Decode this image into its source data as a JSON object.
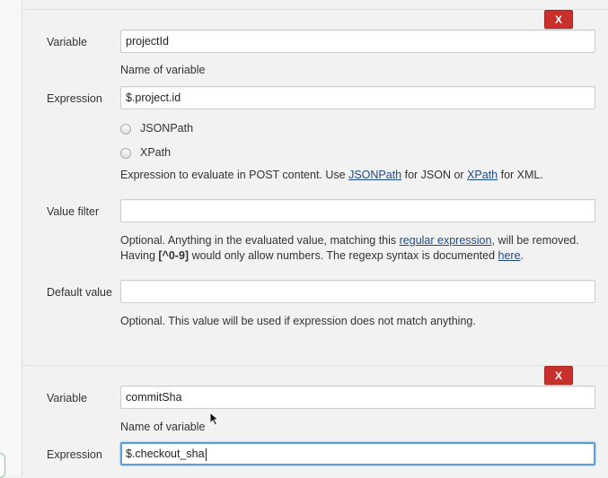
{
  "entries": [
    {
      "delete_label": "X",
      "variable_label": "Variable",
      "variable_value": "projectId",
      "variable_help": "Name of variable",
      "expression_label": "Expression",
      "expression_value": "$.project.id",
      "radio_jsonpath": "JSONPath",
      "radio_xpath": "XPath",
      "expression_help_prefix": "Expression to evaluate in POST content. Use ",
      "expression_help_link1": "JSONPath",
      "expression_help_mid": " for JSON or ",
      "expression_help_link2": "XPath",
      "expression_help_suffix": " for XML.",
      "value_filter_label": "Value filter",
      "value_filter_value": "",
      "value_filter_help_1a": "Optional. Anything in the evaluated value, matching this ",
      "value_filter_help_link1": "regular expression",
      "value_filter_help_1b": ", will be removed.",
      "value_filter_help_2a": "Having ",
      "value_filter_help_bold": "[^0-9]",
      "value_filter_help_2b": " would only allow numbers. The regexp syntax is documented ",
      "value_filter_help_link2": "here",
      "value_filter_help_2c": ".",
      "default_value_label": "Default value",
      "default_value_value": "",
      "default_value_help": "Optional. This value will be used if expression does not match anything."
    },
    {
      "delete_label": "X",
      "variable_label": "Variable",
      "variable_value": "commitSha",
      "variable_help": "Name of variable",
      "expression_label": "Expression",
      "expression_value": "$.checkout_sha"
    }
  ]
}
